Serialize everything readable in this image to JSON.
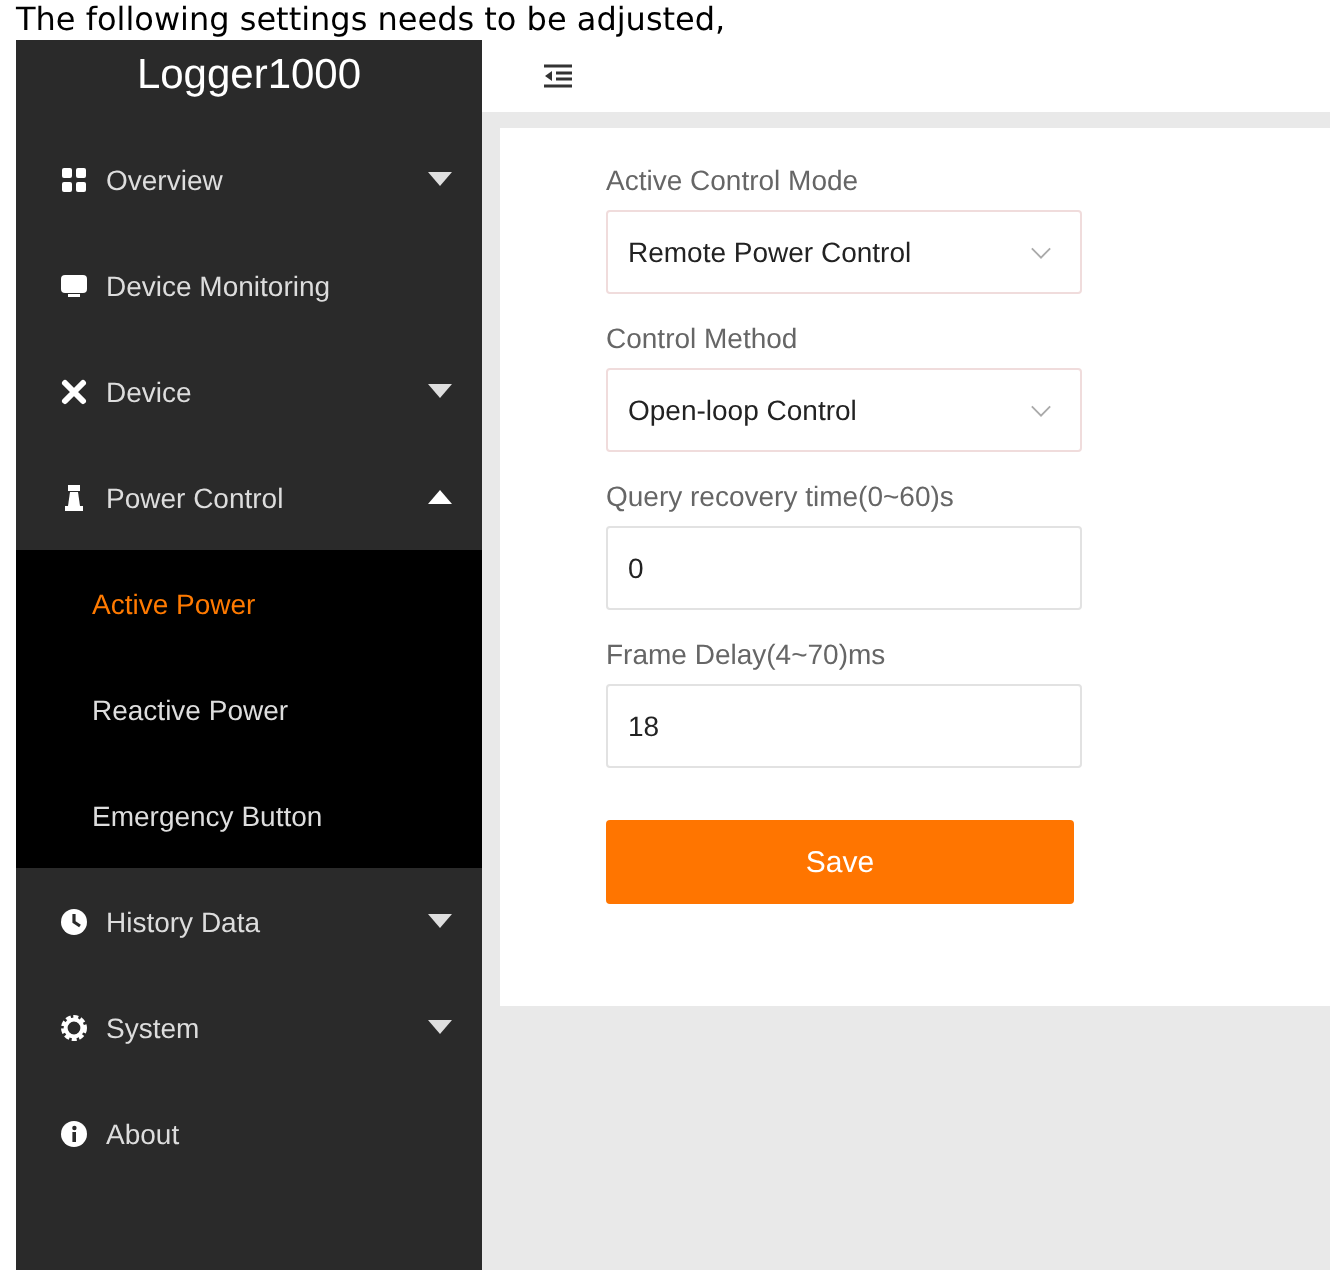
{
  "caption": "The following settings needs to be adjusted,",
  "sidebar": {
    "title": "Logger1000",
    "items": [
      {
        "label": "Overview",
        "expandable": true,
        "expanded": false
      },
      {
        "label": "Device Monitoring",
        "expandable": false
      },
      {
        "label": "Device",
        "expandable": true,
        "expanded": false
      },
      {
        "label": "Power Control",
        "expandable": true,
        "expanded": true,
        "children": [
          {
            "label": "Active Power",
            "selected": true
          },
          {
            "label": "Reactive Power",
            "selected": false
          },
          {
            "label": "Emergency Button",
            "selected": false
          }
        ]
      },
      {
        "label": "History Data",
        "expandable": true,
        "expanded": false
      },
      {
        "label": "System",
        "expandable": true,
        "expanded": false
      },
      {
        "label": "About",
        "expandable": false
      }
    ]
  },
  "form": {
    "fields": [
      {
        "kind": "select",
        "label": "Active Control Mode",
        "value": "Remote Power Control"
      },
      {
        "kind": "select",
        "label": "Control Method",
        "value": "Open-loop Control"
      },
      {
        "kind": "input",
        "label": "Query recovery time(0~60)s",
        "value": "0"
      },
      {
        "kind": "input",
        "label": "Frame Delay(4~70)ms",
        "value": "18"
      }
    ],
    "button": "Save"
  }
}
